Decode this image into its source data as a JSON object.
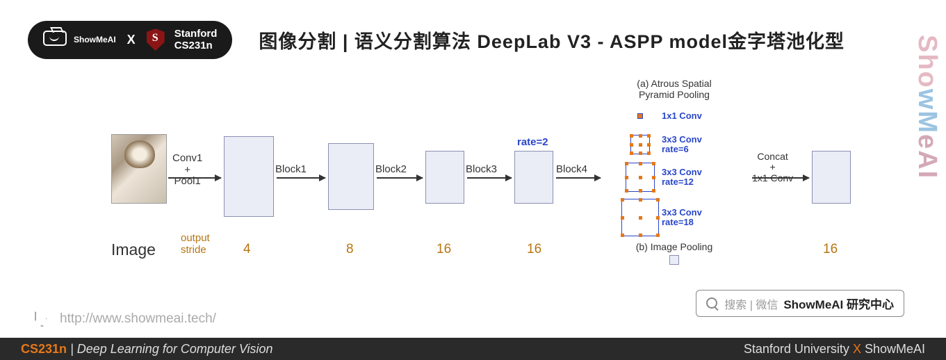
{
  "header": {
    "badge_brand": "ShowMeAI",
    "badge_x": "X",
    "course_line1": "Stanford",
    "course_line2": "CS231n",
    "title": "图像分割 | 语义分割算法 DeepLab V3 - ASPP model金字塔池化型"
  },
  "diagram": {
    "input_label": "Image",
    "output_stride_label": "output\nstride",
    "conn1": "Conv1\n+\nPool1",
    "conn2": "Block1",
    "conn3": "Block2",
    "conn4": "Block3",
    "conn5": "Block4",
    "conn6": "Concat\n+\n1x1 Conv",
    "rate2": "rate=2",
    "strides": {
      "s1": "4",
      "s2": "8",
      "s3": "16",
      "s4": "16",
      "s5": "16"
    },
    "aspp": {
      "title": "(a) Atrous Spatial\nPyramid Pooling",
      "r1": "1x1 Conv",
      "r2": "3x3 Conv\nrate=6",
      "r3": "3x3 Conv\nrate=12",
      "r4": "3x3 Conv\nrate=18",
      "bottom": "(b) Image Pooling"
    }
  },
  "watermark": "ShowMeAI",
  "search": {
    "hint": "搜索 | 微信",
    "brand": "ShowMeAI 研究中心"
  },
  "url": "http://www.showmeai.tech/",
  "footer": {
    "left_cs": "CS231n",
    "left_rest": "| Deep Learning for Computer Vision",
    "right_a": "Stanford University ",
    "right_x": "X",
    "right_b": " ShowMeAI"
  }
}
